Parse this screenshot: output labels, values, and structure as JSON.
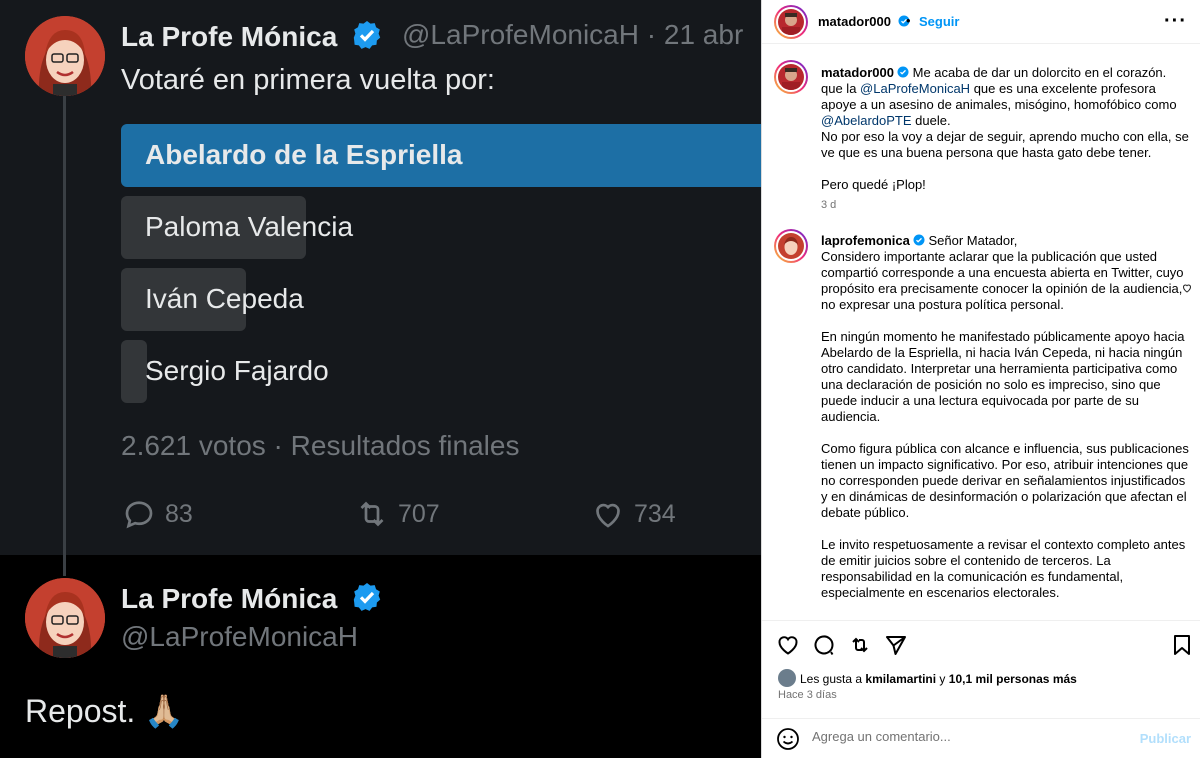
{
  "tweet": {
    "author_name": "La Profe Mónica",
    "author_handle": "@LaProfeMonicaH",
    "date_fragment": "· 21 abr",
    "text": "Votaré en primera vuelta por:",
    "poll": {
      "options": [
        {
          "label": "Abelardo de la Espriella",
          "share": 1.0,
          "winner": true
        },
        {
          "label": "Paloma Valencia",
          "share": 0.28,
          "winner": false
        },
        {
          "label": "Iván Cepeda",
          "share": 0.19,
          "winner": false
        },
        {
          "label": "Sergio Fajardo",
          "share": 0.04,
          "winner": false
        }
      ],
      "meta": "2.621 votos · Resultados finales"
    },
    "actions": {
      "replies": "83",
      "reposts": "707",
      "likes": "734"
    }
  },
  "repost": {
    "author_name": "La Profe Mónica",
    "author_handle": "@LaProfeMonicaH",
    "text": "Repost.",
    "emoji": "🙏🏼"
  },
  "instagram": {
    "header": {
      "username": "matador000",
      "separator": "•",
      "follow_label": "Seguir",
      "more_label": "···"
    },
    "caption": {
      "username": "matador000",
      "line1": "Me acaba de dar un dolorcito en el corazón.",
      "part_a": "que la ",
      "mention_1": "@LaProfeMonicaH",
      "part_b": " que es una excelente profesora apoye a un asesino de animales, misógino, homofóbico como ",
      "mention_2": "@AbelardoPTE",
      "part_c": " duele.",
      "para2": "No por eso la voy a dejar de seguir, aprendo mucho con ella, se ve que es una buena persona que hasta gato debe tener.",
      "para3": "Pero quedé ¡Plop!",
      "time": "3 d"
    },
    "reply": {
      "username": "laprofemonica",
      "p1": "Señor Matador,",
      "p1b": "Considero importante aclarar que la publicación que usted compartió corresponde a una encuesta abierta en Twitter, cuyo propósito era precisamente conocer la opinión de la audiencia, no expresar una postura política personal.",
      "p2": "En ningún momento he manifestado públicamente apoyo hacia Abelardo de la Espriella, ni hacia Iván Cepeda, ni hacia ningún otro candidato. Interpretar una herramienta participativa como una declaración de posición no solo es impreciso, sino que puede inducir a una lectura equivocada por parte de su audiencia.",
      "p3": "Como figura pública con alcance e influencia, sus publicaciones tienen un impacto significativo. Por eso, atribuir intenciones que no corresponden puede derivar en señalamientos injustificados y en dinámicas de desinformación o polarización que afectan el debate público.",
      "p4": "Le invito respetuosamente a revisar el contexto completo antes de emitir juicios sobre el contenido de terceros. La responsabilidad en la comunicación es fundamental, especialmente en escenarios electorales."
    },
    "likes": {
      "prefix": "Les gusta a ",
      "user": "kmilamartini",
      "middle": " y ",
      "others": "10,1 mil personas más"
    },
    "time_ago": "Hace 3 días",
    "comment": {
      "placeholder": "Agrega un comentario...",
      "post_label": "Publicar"
    },
    "colors": {
      "link": "#0095f6",
      "mention": "#00376b",
      "poll_winner": "#1d6fa5",
      "poll_other": "#333639"
    }
  }
}
